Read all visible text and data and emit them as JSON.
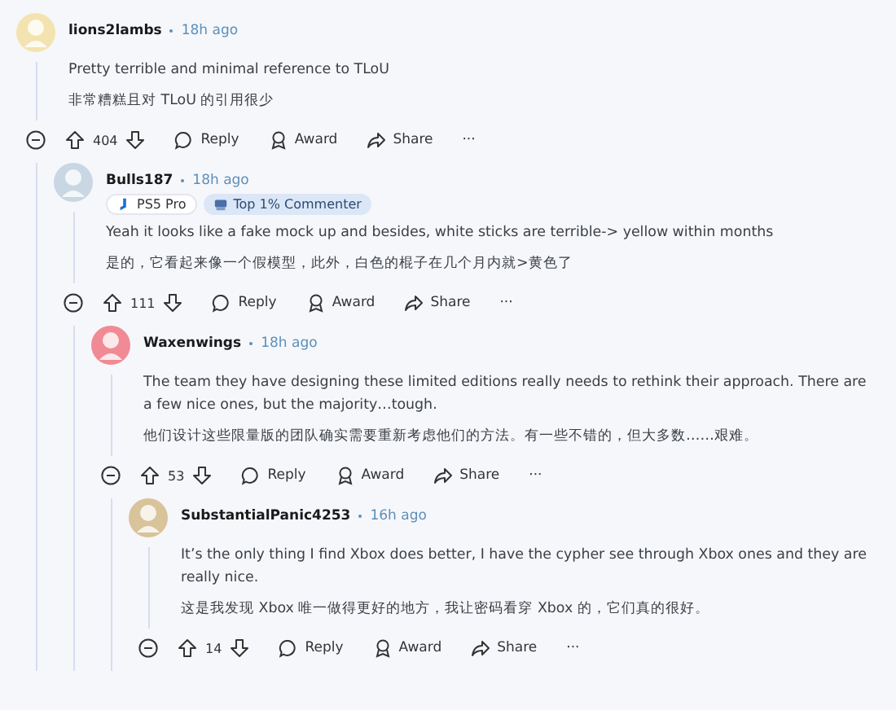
{
  "comments": [
    {
      "author": "lions2lambs",
      "time": "18h ago",
      "text": [
        "Pretty terrible and minimal reference to TLoU",
        "非常糟糕且对 TLoU 的引用很少"
      ],
      "votes": "404",
      "actions": [
        "Reply",
        "Award",
        "Share"
      ],
      "more": "···",
      "children": [
        {
          "author": "Bulls187",
          "time": "18h ago",
          "badges": [
            {
              "label": "PS5 Pro",
              "kind": "flair"
            },
            {
              "label": "Top 1% Commenter",
              "kind": "achievement"
            }
          ],
          "text": [
            "Yeah it looks like a fake mock up and besides, white sticks are terrible-> yellow within months",
            "是的，它看起来像一个假模型，此外，白色的棍子在几个月内就>黄色了"
          ],
          "votes": "111",
          "actions": [
            "Reply",
            "Award",
            "Share"
          ],
          "more": "···",
          "children": [
            {
              "author": "Waxenwings",
              "time": "18h ago",
              "text": [
                "The team they have designing these limited editions really needs to rethink their approach. There are a few nice ones, but the majority…tough.",
                "他们设计这些限量版的团队确实需要重新考虑他们的方法。有一些不错的，但大多数……艰难。"
              ],
              "votes": "53",
              "actions": [
                "Reply",
                "Award",
                "Share"
              ],
              "more": "···",
              "children": [
                {
                  "author": "SubstantialPanic4253",
                  "time": "16h ago",
                  "text": [
                    "It’s the only thing I find Xbox does better, I have the cypher see through Xbox ones and they are really nice.",
                    "这是我发现 Xbox 唯一做得更好的地方，我让密码看穿 Xbox 的，它们真的很好。"
                  ],
                  "votes": "14",
                  "actions": [
                    "Reply",
                    "Award",
                    "Share"
                  ],
                  "more": "···"
                }
              ]
            }
          ]
        }
      ]
    }
  ]
}
